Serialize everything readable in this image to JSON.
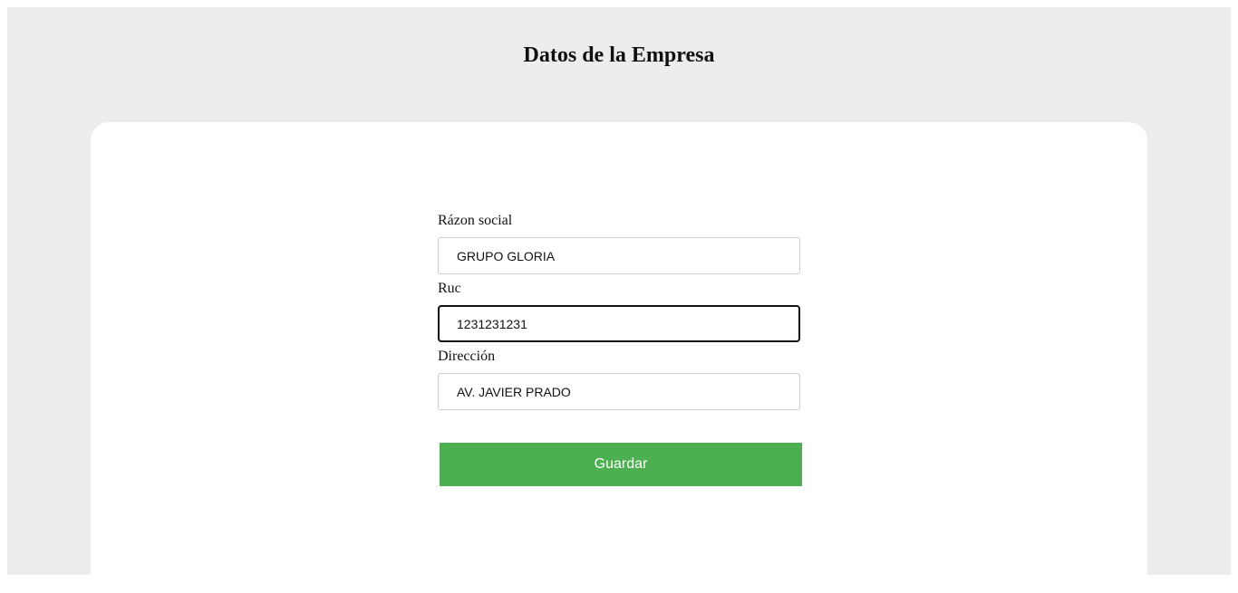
{
  "page": {
    "title": "Datos de la Empresa"
  },
  "form": {
    "razon_social": {
      "label": "Rázon social",
      "value": "GRUPO GLORIA"
    },
    "ruc": {
      "label": "Ruc",
      "value": "1231231231"
    },
    "direccion": {
      "label": "Dirección",
      "value": "AV. JAVIER PRADO"
    },
    "submit_label": "Guardar"
  },
  "colors": {
    "background": "#eceeee",
    "card": "#ffffff",
    "button": "#4caf50",
    "button_text": "#ffffff"
  }
}
